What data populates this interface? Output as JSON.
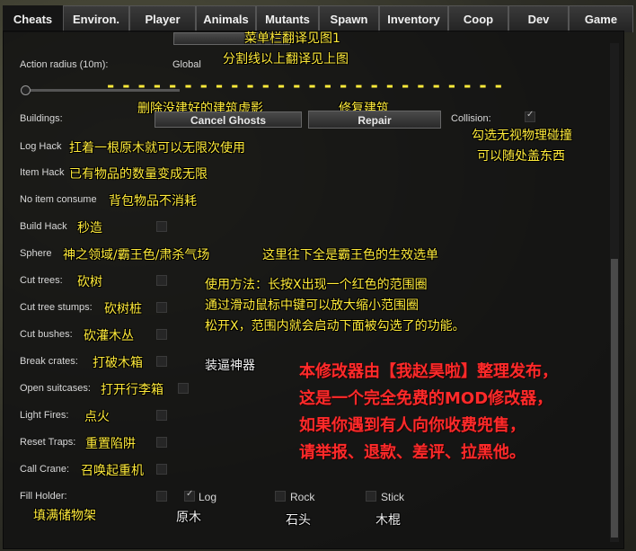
{
  "tabs": [
    "Cheats",
    "Environ.",
    "Player",
    "Animals",
    "Mutants",
    "Spawn",
    "Inventory",
    "Coop",
    "Dev",
    "Game"
  ],
  "annotations": {
    "menu_note": "菜单栏翻译见图1",
    "divider_note": "分割线以上翻译见上图",
    "dashes": "- - - - - - - - - - - - - - - - - - - - - - - - - -",
    "cancel_ghosts_cn": "删除没建好的建筑虚影",
    "repair_cn": "修复建筑",
    "collision_cn1": "勾选无视物理碰撞",
    "collision_cn2": "可以随处盖东西",
    "log_hack_cn": "扛着一根原木就可以无限次使用",
    "item_hack_cn": "已有物品的数量变成无限",
    "no_item_consume_cn": "背包物品不消耗",
    "build_hack_cn": "秒造",
    "sphere_cn": "神之领域/霸王色/肃杀气场",
    "sphere_note_cn": "这里往下全是霸王色的生效选单",
    "usage1": "使用方法：长按X出现一个红色的范围圈",
    "usage2": "通过滑动鼠标中键可以放大缩小范围圈",
    "usage3": "松开X，范围内就会启动下面被勾选了的功能。",
    "cut_trees_cn": "砍树",
    "cut_stumps_cn": "砍树桩",
    "cut_bushes_cn": "砍灌木丛",
    "break_crates_cn": "打破木箱",
    "open_suitcases_cn": "打开行李箱",
    "light_fires_cn": "点火",
    "reset_traps_cn": "重置陷阱",
    "call_crane_cn": "召唤起重机",
    "fill_holder_cn": "填满储物架",
    "log_cn": "原木",
    "rock_cn": "石头",
    "stick_cn": "木棍",
    "artifact": "装逼神器",
    "notice1": "本修改器由【我赵昊啦】整理发布，",
    "notice2": "这是一个完全免费的MOD修改器，",
    "notice3": "如果你遇到有人向你收费兜售，",
    "notice4": "请举报、退款、差评、拉黑他。"
  },
  "labels": {
    "action_radius": "Action radius (10m):",
    "global": "Global",
    "buildings": "Buildings:",
    "cancel_ghosts": "Cancel Ghosts",
    "repair": "Repair",
    "collision": "Collision:",
    "log_hack": "Log Hack",
    "item_hack": "Item Hack",
    "no_item_consume": "No item consume",
    "build_hack": "Build Hack",
    "sphere": "Sphere",
    "cut_trees": "Cut trees:",
    "cut_stumps": "Cut tree stumps:",
    "cut_bushes": "Cut bushes:",
    "break_crates": "Break crates:",
    "open_suitcases": "Open suitcases:",
    "light_fires": "Light Fires:",
    "reset_traps": "Reset Traps:",
    "call_crane": "Call Crane:",
    "fill_holder": "Fill Holder:",
    "log": "Log",
    "rock": "Rock",
    "stick": "Stick"
  },
  "state": {
    "collision_checked": true,
    "log_checked": true,
    "action_radius_fraction": 0.0
  }
}
